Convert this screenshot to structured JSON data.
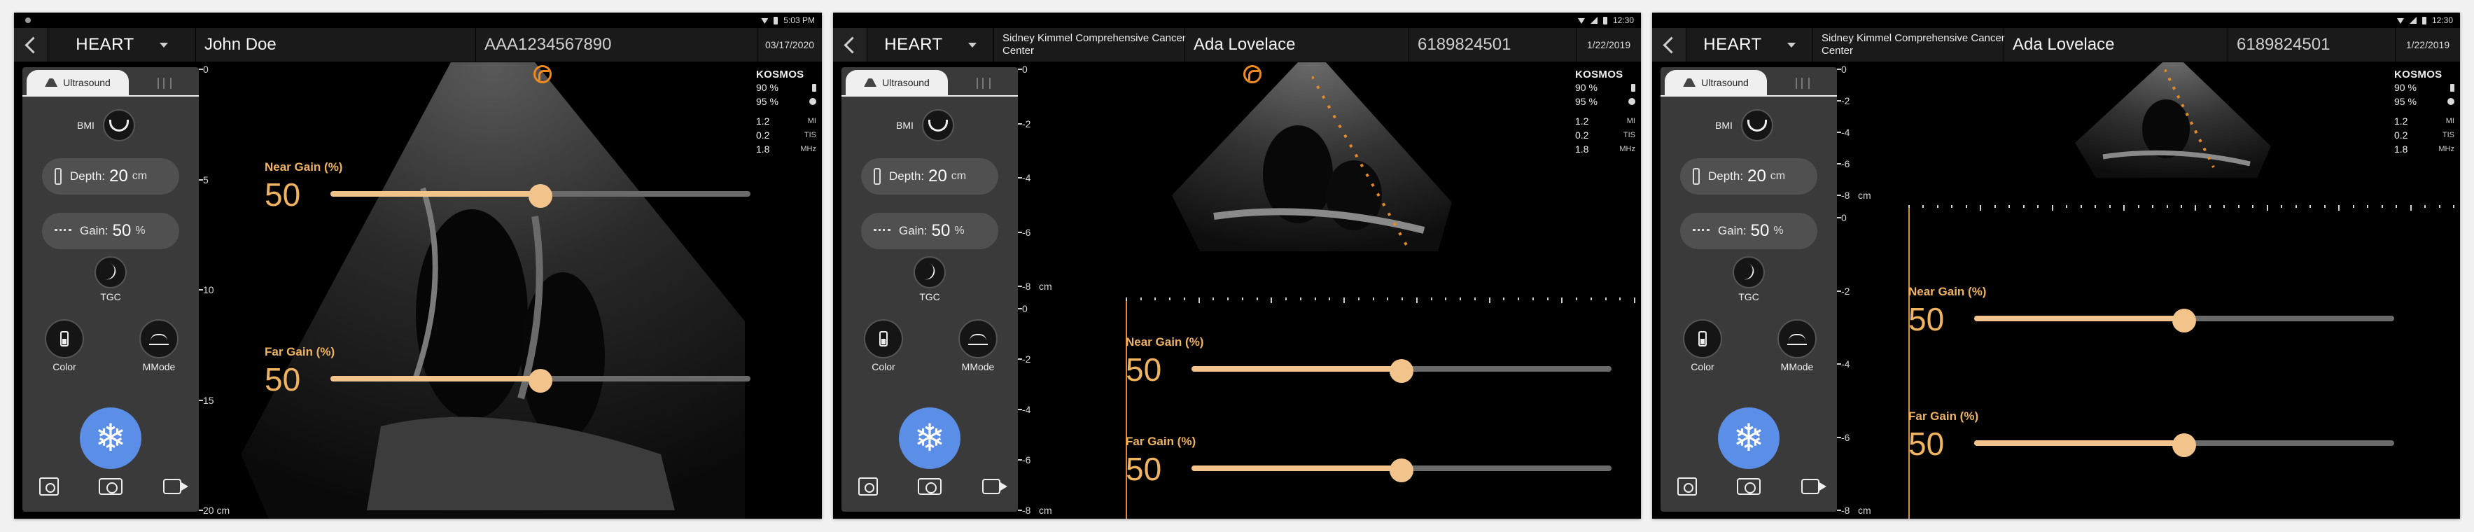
{
  "panels": [
    {
      "status": {
        "time": "5:03 PM"
      },
      "header": {
        "preset": "HEART",
        "institution_line1": "",
        "institution_line2": "",
        "patient_name": "John Doe",
        "patient_id": "AAA1234567890",
        "date": "03/17/2020"
      },
      "sidebar": {
        "tab_label": "Ultrasound",
        "bmi_label": "BMI",
        "depth": {
          "label": "Depth:",
          "value": "20",
          "unit": "cm"
        },
        "gain": {
          "label": "Gain:",
          "value": "50",
          "unit": "%"
        },
        "tgc_label": "TGC",
        "color_label": "Color",
        "mmode_label": "MMode"
      },
      "info": {
        "brand": "KOSMOS",
        "battery": "90 %",
        "brightness": "95 %",
        "mi_value": "1.2",
        "mi_unit": "MI",
        "tis_value": "0.2",
        "tis_unit": "TIS",
        "freq_value": "1.8",
        "freq_unit": "MHz"
      },
      "scale": {
        "labels": [
          "0",
          "5",
          "10",
          "15",
          "20 cm"
        ],
        "max": 20
      },
      "cine_scale": null,
      "near_gain": {
        "label": "Near Gain (%)",
        "value": "50",
        "level": 0.5
      },
      "far_gain": {
        "label": "Far Gain (%)",
        "value": "50",
        "level": 0.5
      },
      "accent": "#f0b35f",
      "freeze_color": "#5b8ee6"
    },
    {
      "status": {
        "time": "12:30"
      },
      "header": {
        "preset": "HEART",
        "institution_line1": "Sidney Kimmel Comprehensive Cancer",
        "institution_line2": "Center",
        "patient_name": "Ada Lovelace",
        "patient_id": "6189824501",
        "date": "1/22/2019"
      },
      "sidebar": {
        "tab_label": "Ultrasound",
        "bmi_label": "BMI",
        "depth": {
          "label": "Depth:",
          "value": "20",
          "unit": "cm"
        },
        "gain": {
          "label": "Gain:",
          "value": "50",
          "unit": "%"
        },
        "tgc_label": "TGC",
        "color_label": "Color",
        "mmode_label": "MMode"
      },
      "info": {
        "brand": "KOSMOS",
        "battery": "90 %",
        "brightness": "95 %",
        "mi_value": "1.2",
        "mi_unit": "MI",
        "tis_value": "0.2",
        "tis_unit": "TIS",
        "freq_value": "1.8",
        "freq_unit": "MHz"
      },
      "scale": {
        "labels": [
          "0",
          "-2",
          "-4",
          "-6",
          "-8",
          "cm"
        ],
        "max": 8
      },
      "cine_scale": {
        "labels": [
          "0",
          "-2",
          "-4",
          "-6",
          "-8",
          "cm"
        ],
        "max": 8
      },
      "near_gain": {
        "label": "Near Gain (%)",
        "value": "50",
        "level": 0.5
      },
      "far_gain": {
        "label": "Far Gain (%)",
        "value": "50",
        "level": 0.5
      },
      "accent": "#f0b35f",
      "freeze_color": "#5b8ee6"
    },
    {
      "status": {
        "time": "12:30"
      },
      "header": {
        "preset": "HEART",
        "institution_line1": "Sidney Kimmel Comprehensive Cancer",
        "institution_line2": "Center",
        "patient_name": "Ada Lovelace",
        "patient_id": "6189824501",
        "date": "1/22/2019"
      },
      "sidebar": {
        "tab_label": "Ultrasound",
        "bmi_label": "BMI",
        "depth": {
          "label": "Depth:",
          "value": "20",
          "unit": "cm"
        },
        "gain": {
          "label": "Gain:",
          "value": "50",
          "unit": "%"
        },
        "tgc_label": "TGC",
        "color_label": "Color",
        "mmode_label": "MMode"
      },
      "info": {
        "brand": "KOSMOS",
        "battery": "90 %",
        "brightness": "95 %",
        "mi_value": "1.2",
        "mi_unit": "MI",
        "tis_value": "0.2",
        "tis_unit": "TIS",
        "freq_value": "1.8",
        "freq_unit": "MHz"
      },
      "scale": {
        "labels": [
          "0",
          "-2",
          "-4",
          "-6",
          "-8",
          "cm"
        ],
        "max": 8
      },
      "cine_scale": {
        "labels": [
          "0",
          "-2",
          "-4",
          "-6",
          "-8",
          "cm"
        ],
        "max": 8
      },
      "near_gain": {
        "label": "Near Gain (%)",
        "value": "50",
        "level": 0.5
      },
      "far_gain": {
        "label": "Far Gain (%)",
        "value": "50",
        "level": 0.5
      },
      "accent": "#f0b35f",
      "freeze_color": "#5b8ee6"
    }
  ]
}
